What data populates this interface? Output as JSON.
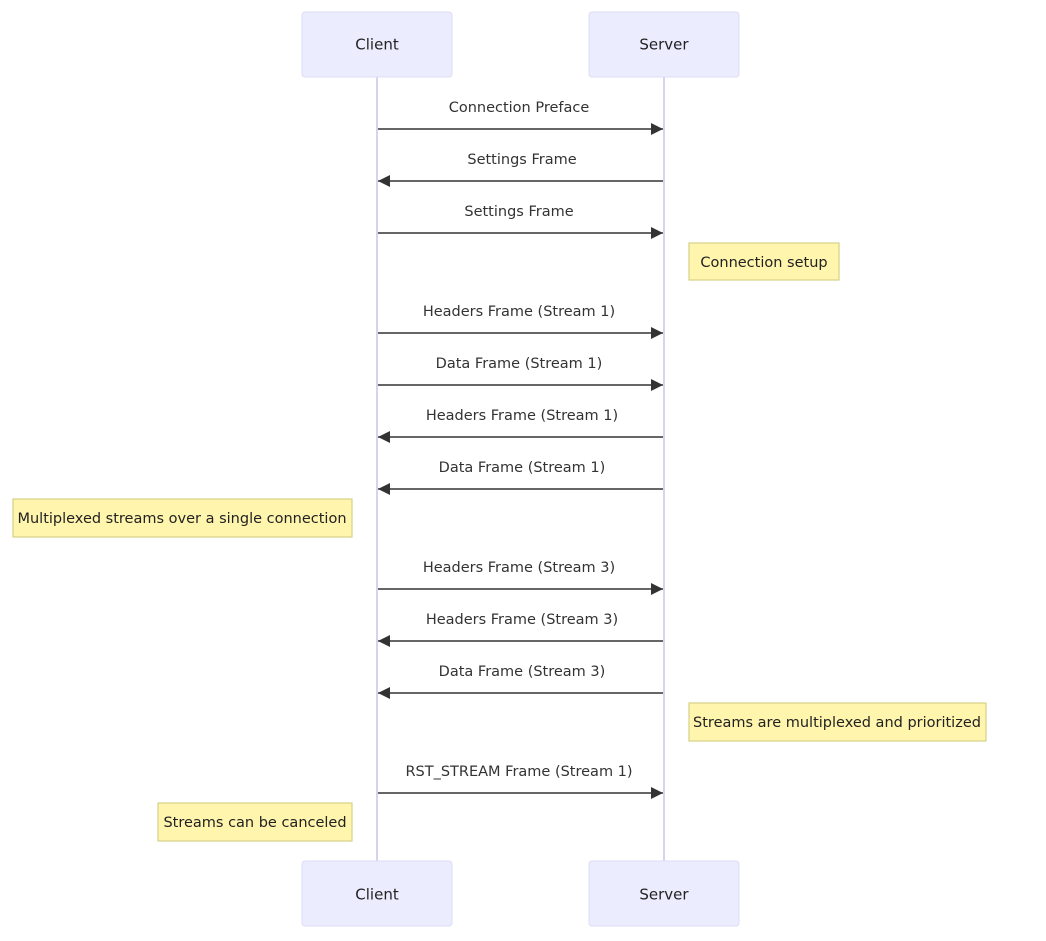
{
  "diagram": {
    "type": "sequence",
    "participants": [
      {
        "id": "client",
        "label": "Client"
      },
      {
        "id": "server",
        "label": "Server"
      }
    ],
    "steps": [
      {
        "kind": "message",
        "from": "client",
        "to": "server",
        "label": "Connection Preface"
      },
      {
        "kind": "message",
        "from": "server",
        "to": "client",
        "label": "Settings Frame"
      },
      {
        "kind": "message",
        "from": "client",
        "to": "server",
        "label": "Settings Frame"
      },
      {
        "kind": "note",
        "side": "right-of",
        "of": "server",
        "label": "Connection setup"
      },
      {
        "kind": "message",
        "from": "client",
        "to": "server",
        "label": "Headers Frame (Stream 1)"
      },
      {
        "kind": "message",
        "from": "client",
        "to": "server",
        "label": "Data Frame (Stream 1)"
      },
      {
        "kind": "message",
        "from": "server",
        "to": "client",
        "label": "Headers Frame (Stream 1)"
      },
      {
        "kind": "message",
        "from": "server",
        "to": "client",
        "label": "Data Frame (Stream 1)"
      },
      {
        "kind": "note",
        "side": "left-of",
        "of": "client",
        "label": "Multiplexed streams over a single connection"
      },
      {
        "kind": "message",
        "from": "client",
        "to": "server",
        "label": "Headers Frame (Stream 3)"
      },
      {
        "kind": "message",
        "from": "server",
        "to": "client",
        "label": "Headers Frame (Stream 3)"
      },
      {
        "kind": "message",
        "from": "server",
        "to": "client",
        "label": "Data Frame (Stream 3)"
      },
      {
        "kind": "note",
        "side": "right-of",
        "of": "server",
        "label": "Streams are multiplexed and prioritized"
      },
      {
        "kind": "message",
        "from": "client",
        "to": "server",
        "label": "RST_STREAM Frame (Stream 1)"
      },
      {
        "kind": "note",
        "side": "left-of",
        "of": "client",
        "label": "Streams can be canceled"
      }
    ]
  },
  "colors": {
    "actor_fill": "#ececff",
    "note_fill": "#fff5ad",
    "arrow": "#333333",
    "lifeline": "#d4d4ec"
  }
}
